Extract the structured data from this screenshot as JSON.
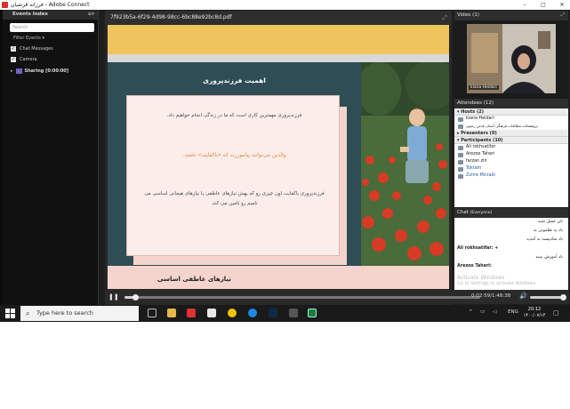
{
  "window": {
    "title": "فرزانه فرشیان - Adobe Connect",
    "minimize": "–",
    "maximize": "□",
    "close": "✕"
  },
  "events_index": {
    "header": "Events Index",
    "menu_icon": "≡▾",
    "search_placeholder": "Search",
    "filter_label": "Filter Events",
    "items": [
      {
        "label": "Chat Messages",
        "checked": true
      },
      {
        "label": "Camera",
        "checked": true
      }
    ],
    "sharing": "Sharing [0:00:00]"
  },
  "document": {
    "filename": "7f923b5a-6f29-4d98-98cc-6bc88e92bc8d.pdf",
    "slide": {
      "title": "اهمیت فرزندپروری",
      "line1": "فرزندپروری مهمترین کاری است که ما در زندگی انجام خواهیم داد.",
      "line2": "والدین می‌توانند پیامورزند که «باکفایت» باشند.",
      "line3": "فرزندپروری باکفایت اون چیزی رو که بهش نیازهای عاطفی یا نیازهای هیجانی اساسی می نامیم رو تامین می کند.",
      "next_title": "نیازهای عاطفی اساسی"
    }
  },
  "playback": {
    "pause_icon": "❚❚",
    "time": "0:02:59/1:48:38",
    "volume_icon": "🔊",
    "progress": 0.03,
    "volume": 0.9
  },
  "video_pod": {
    "title": "Video",
    "count": "(1)",
    "caption": "kiana Heidari"
  },
  "attendees": {
    "title": "Attendees",
    "count": "(12)",
    "hosts_label": "Hosts (2)",
    "hosts": [
      "kiana Heidari",
      "پژوهشکده مطالعات فرهنگی آستان قدس رضوی"
    ],
    "presenters_label": "Presenters (0)",
    "participants_label": "Participants (10)",
    "participants": [
      "Ali rokhsatifar",
      "Arezoo Taheri",
      "farzan zin",
      "Toktam",
      "Zohre Mirzadi"
    ]
  },
  "chat": {
    "title": "Chat",
    "scope": "(Everyone)",
    "messages": [
      {
        "text": "تان عسل شید",
        "bold": false
      },
      {
        "text": "باد یه نظمونی به",
        "bold": false
      },
      {
        "text": "باد سادپیسه به آمدید",
        "bold": false
      },
      {
        "text": "Ali rokhsatifar: +",
        "bold": true
      },
      {
        "text": "باد آموزش ببیند",
        "bold": false
      },
      {
        "text": "Arezoo Taheri:",
        "bold": true
      }
    ],
    "watermark1": "Activate Windows",
    "watermark2": "Go to Settings to activate Windows."
  },
  "taskbar": {
    "search_placeholder": "Type here to search",
    "tray_lang": "ENG",
    "time": "20:12",
    "date": "۱۴۰۰/۰۷/۱۴"
  }
}
